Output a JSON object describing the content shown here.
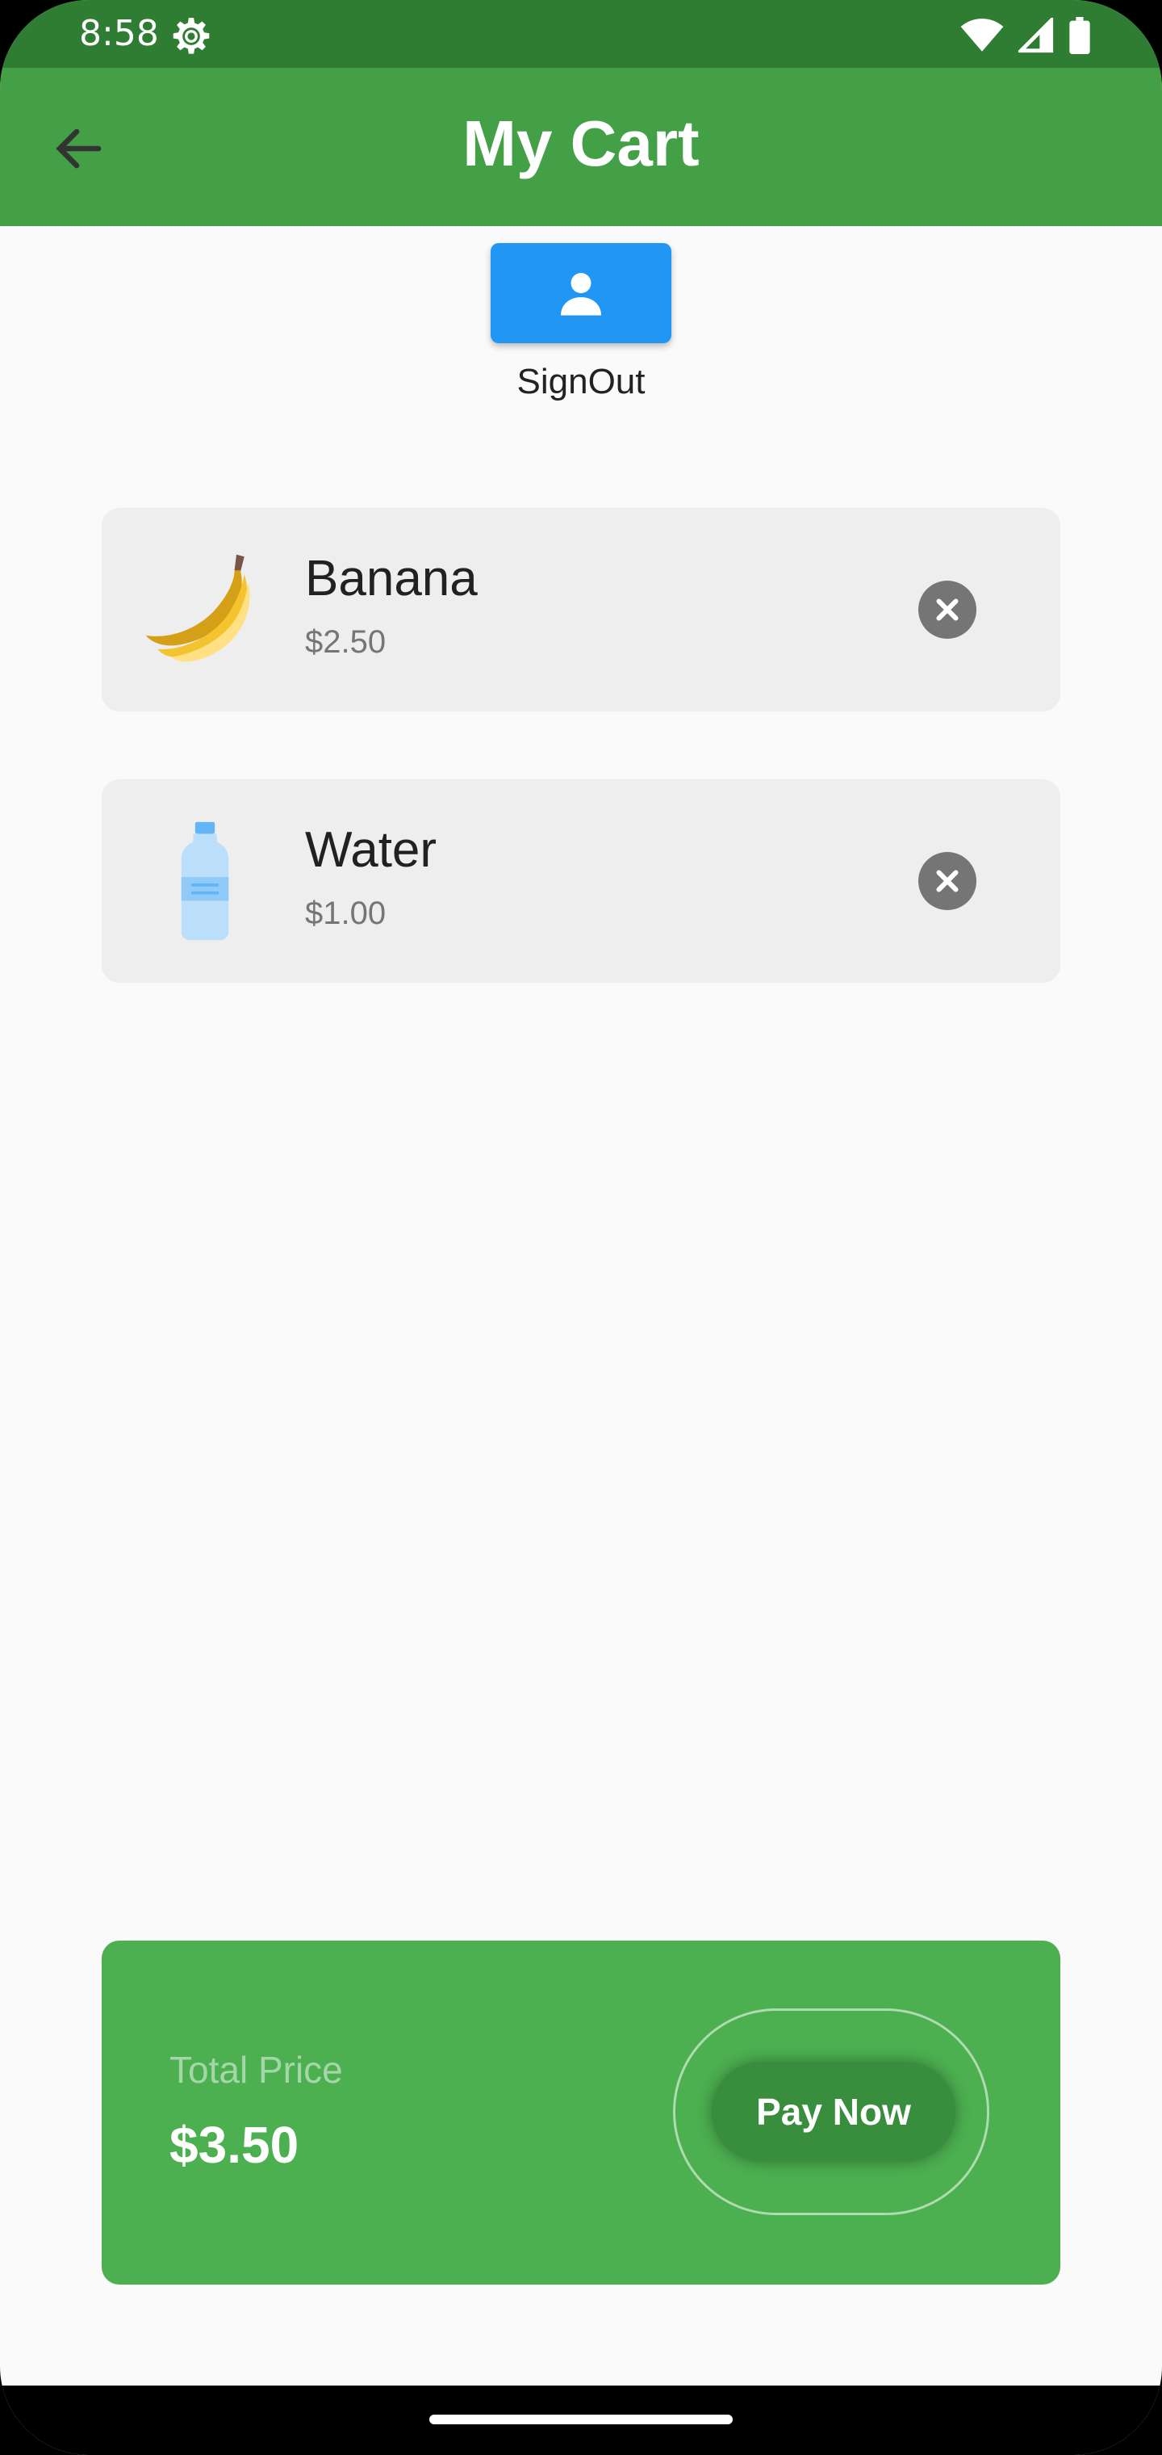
{
  "status_bar": {
    "time": "8:58"
  },
  "app_bar": {
    "title": "My Cart"
  },
  "signout": {
    "label": "SignOut"
  },
  "cart": {
    "items": [
      {
        "name": "Banana",
        "price": "$2.50",
        "icon": "banana-icon"
      },
      {
        "name": "Water",
        "price": "$1.00",
        "icon": "water-bottle-icon"
      }
    ]
  },
  "total": {
    "label": "Total Price",
    "value": "$3.50",
    "pay_label": "Pay Now"
  },
  "colors": {
    "status_bar": "#2e7d32",
    "app_bar": "#43a047",
    "signout_button": "#2196f3",
    "total_card": "#4caf50",
    "pay_button": "#388e3c"
  }
}
